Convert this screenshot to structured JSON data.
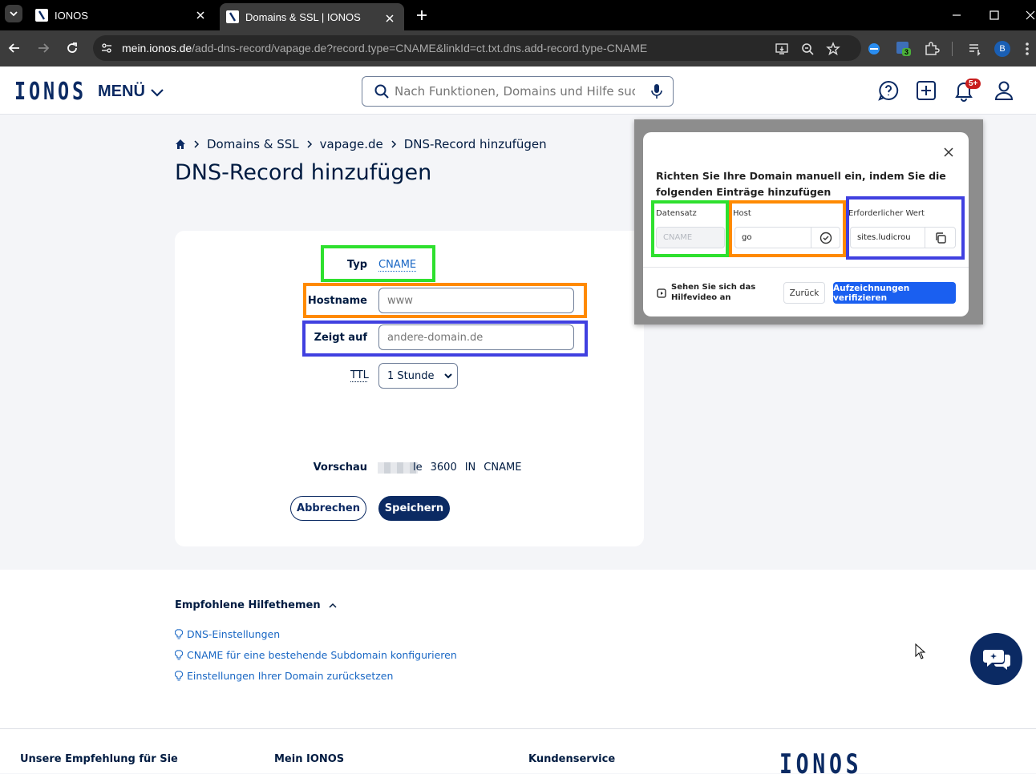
{
  "browser": {
    "tabs": [
      {
        "title": "IONOS"
      },
      {
        "title": "Domains & SSL | IONOS"
      }
    ],
    "url_domain": "mein.ionos.de",
    "url_path": "/add-dns-record/vapage.de?record.type=CNAME&linkId=ct.txt.dns.add-record.type-CNAME",
    "extension_badge": "3",
    "profile_initial": "B"
  },
  "header": {
    "logo": "IONOS",
    "menu_label": "MENÜ",
    "search_placeholder": "Nach Funktionen, Domains und Hilfe suchen",
    "notification_badge": "5+"
  },
  "breadcrumb": {
    "items": [
      "Domains & SSL",
      "vapage.de",
      "DNS-Record hinzufügen"
    ]
  },
  "page_title": "DNS-Record hinzufügen",
  "form": {
    "type_label": "Typ",
    "type_value": "CNAME",
    "hostname_label": "Hostname",
    "hostname_placeholder": "www",
    "points_to_label": "Zeigt auf",
    "points_to_placeholder": "andere-domain.de",
    "ttl_label": "TTL",
    "ttl_value": "1 Stunde",
    "preview_label": "Vorschau",
    "preview_value_suffix": "le",
    "preview_ttl": "3600",
    "preview_class": "IN",
    "preview_type": "CNAME",
    "cancel_label": "Abbrechen",
    "save_label": "Speichern"
  },
  "highlight_colors": {
    "green": "#2ee02e",
    "orange": "#ff8a00",
    "blue": "#4040e0"
  },
  "modal": {
    "heading": "Richten Sie Ihre Domain manuell ein, indem Sie die folgenden Einträge hinzufügen",
    "col_record": "Datensatz",
    "col_host": "Host",
    "col_value": "Erforderlicher Wert",
    "record_value": "CNAME",
    "host_value": "go",
    "required_value": "sites.ludicrou",
    "help_video": "Sehen Sie sich das Hilfevideo an",
    "back_label": "Zurück",
    "verify_label": "Aufzeichnungen verifizieren",
    "accent": "#1a5ff0"
  },
  "help": {
    "title": "Empfohlene Hilfethemen",
    "links": [
      "DNS-Einstellungen",
      "CNAME für eine bestehende Subdomain konfigurieren",
      "Einstellungen Ihrer Domain zurücksetzen"
    ]
  },
  "footer": {
    "col1": "Unsere Empfehlung für Sie",
    "col2": "Mein IONOS",
    "col3": "Kundenservice",
    "logo": "IONOS"
  }
}
